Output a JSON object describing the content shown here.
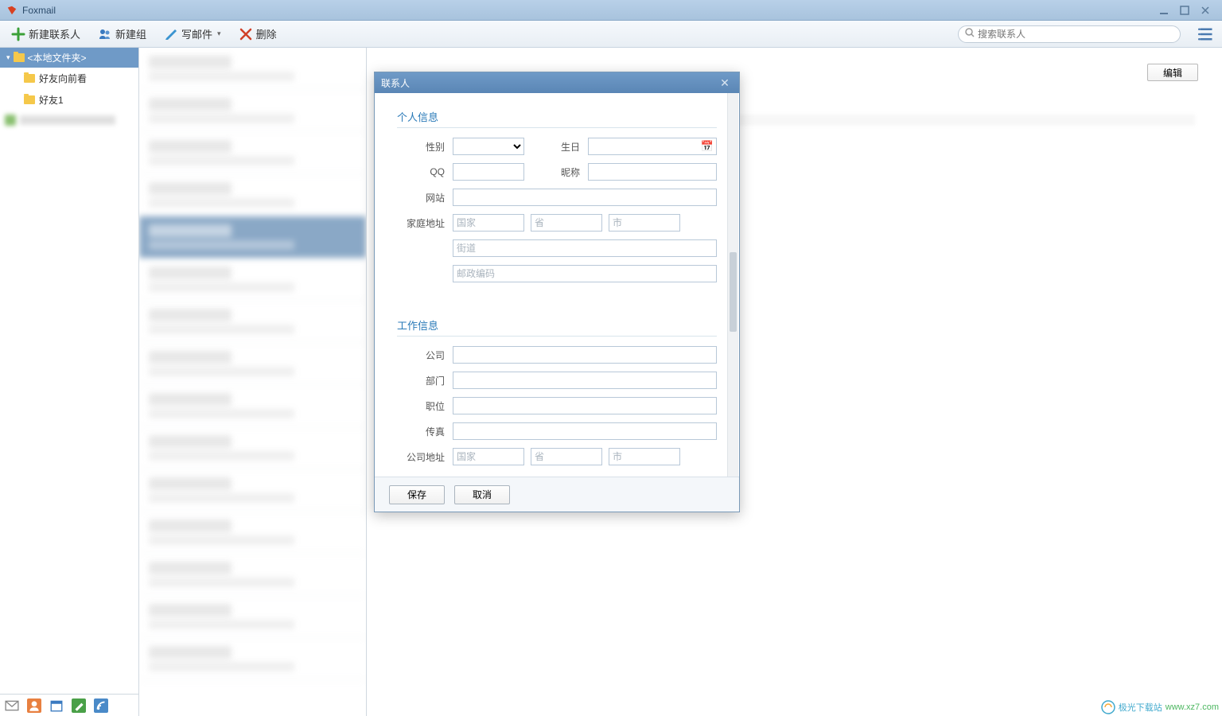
{
  "app": {
    "title": "Foxmail"
  },
  "toolbar": {
    "new_contact": "新建联系人",
    "new_group": "新建组",
    "compose": "写邮件",
    "delete": "删除",
    "search_placeholder": "搜索联系人"
  },
  "sidebar": {
    "root": "<本地文件夹>",
    "folders": [
      "好友向前看",
      "好友1"
    ]
  },
  "detail": {
    "edit": "编辑"
  },
  "dialog": {
    "title": "联系人",
    "sections": {
      "personal": "个人信息",
      "work": "工作信息"
    },
    "labels": {
      "gender": "性别",
      "birthday": "生日",
      "qq": "QQ",
      "nick": "昵称",
      "website": "网站",
      "home_addr": "家庭地址",
      "company": "公司",
      "department": "部门",
      "position": "职位",
      "fax": "传真",
      "company_addr": "公司地址"
    },
    "placeholders": {
      "country": "国家",
      "province": "省",
      "city": "市",
      "street": "街道",
      "zip": "邮政编码"
    },
    "save": "保存",
    "cancel": "取消"
  },
  "watermark": {
    "name": "极光下载站",
    "url": "www.xz7.com"
  }
}
